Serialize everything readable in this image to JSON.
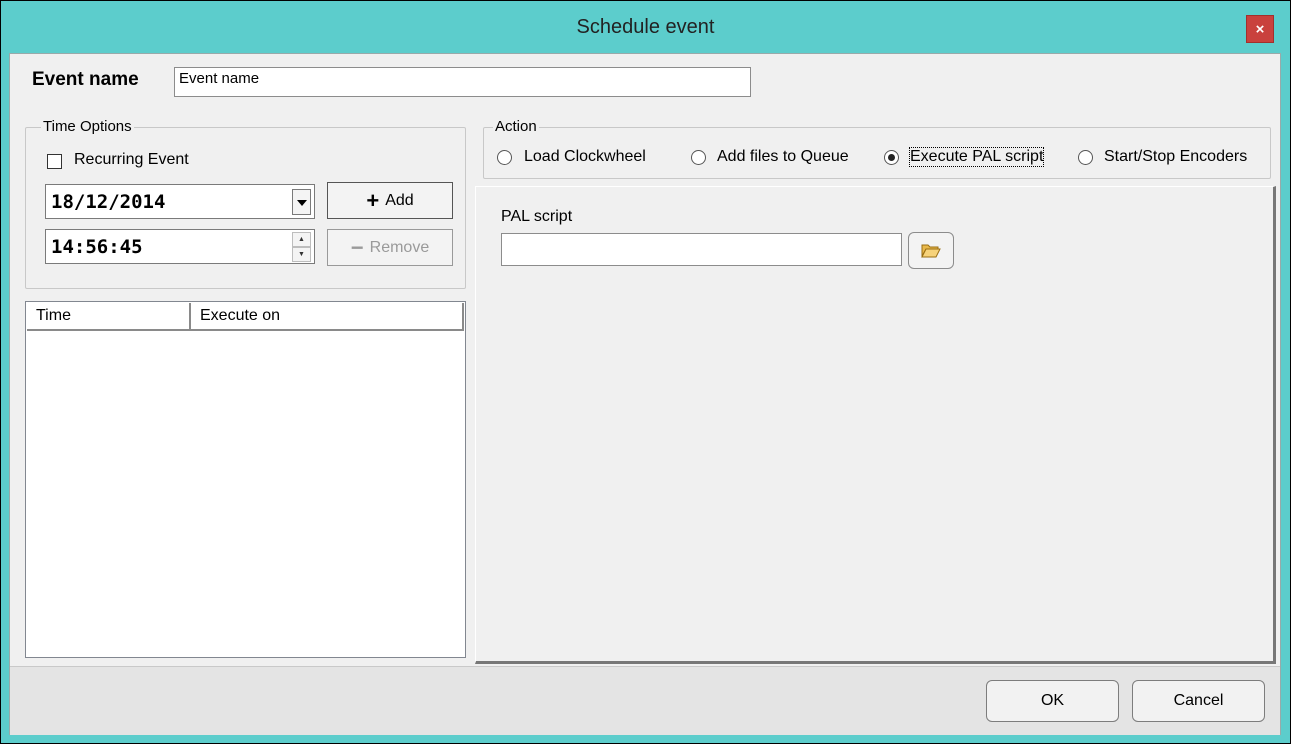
{
  "window": {
    "title": "Schedule event",
    "close_glyph": "×"
  },
  "event_name": {
    "label": "Event name",
    "value": "Event name"
  },
  "time_options": {
    "legend": "Time Options",
    "recurring_label": "Recurring Event",
    "recurring_checked": false,
    "date_value": "18/12/2014",
    "time_value": "14:56:45",
    "add_label": "Add",
    "remove_label": "Remove"
  },
  "schedule_list": {
    "columns": [
      "Time",
      "Execute on"
    ],
    "rows": []
  },
  "action": {
    "legend": "Action",
    "options": [
      "Load Clockwheel",
      "Add files to Queue",
      "Execute PAL script",
      "Start/Stop Encoders"
    ],
    "selected": "Execute PAL script"
  },
  "pal_script": {
    "label": "PAL script",
    "value": "",
    "browse_icon": "folder-open-icon"
  },
  "footer": {
    "ok_label": "OK",
    "cancel_label": "Cancel"
  },
  "colors": {
    "titlebar": "#5ccdcc",
    "close_button": "#c9413d",
    "dialog_bg": "#f0f0f0"
  }
}
